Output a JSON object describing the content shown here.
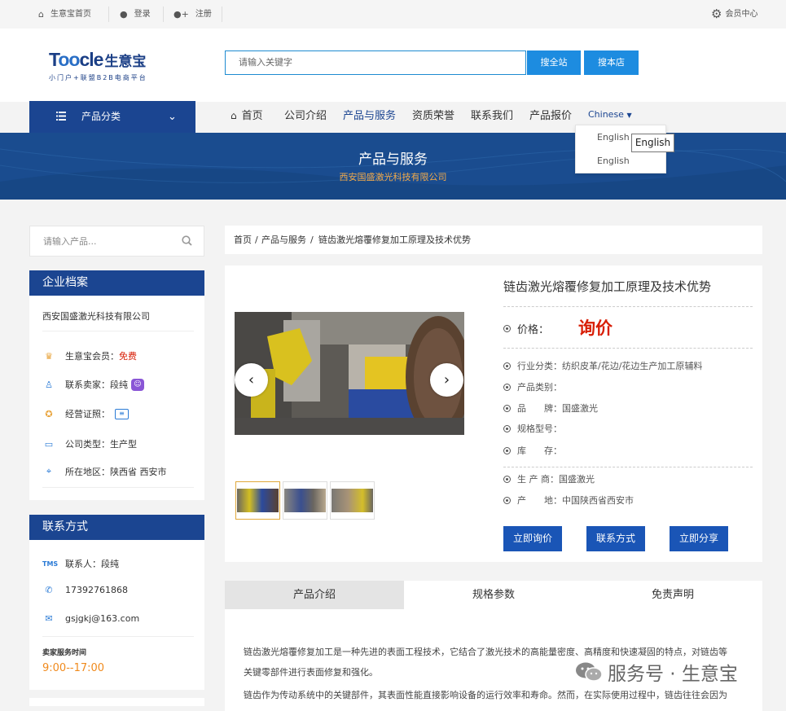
{
  "topbar": {
    "home": "生意宝首页",
    "login": "登录",
    "register": "注册",
    "member_center": "会员中心"
  },
  "logo": {
    "text_prefix": "T",
    "text_oo": "oo",
    "text_suffix": "cle",
    "cn_name": "生意宝",
    "tagline": "小门户+联盟B2B电商平台"
  },
  "search": {
    "placeholder": "请输入关键字",
    "btn_all": "搜全站",
    "btn_store": "搜本店"
  },
  "nav": {
    "category_label": "产品分类",
    "links": [
      "首页",
      "公司介绍",
      "产品与服务",
      "资质荣誉",
      "联系我们",
      "产品报价"
    ],
    "active": "产品与服务",
    "language": "Chinese",
    "language_options": [
      "English",
      "English"
    ],
    "tooltip": "English"
  },
  "banner": {
    "title": "产品与服务",
    "company": "西安国盛激光科技有限公司"
  },
  "sidebar": {
    "search_placeholder": "请输入产品...",
    "profile": {
      "heading": "企业档案",
      "company": "西安国盛激光科技有限公司",
      "member_label": "生意宝会员：",
      "member_value": "免费",
      "seller_label": "联系卖家：",
      "seller_value": "段纯",
      "license_label": "经营证照：",
      "type_label": "公司类型：",
      "type_value": "生产型",
      "region_label": "所在地区：",
      "region_value": "陕西省 西安市"
    },
    "contact": {
      "heading": "联系方式",
      "person": "联系人：段纯",
      "phone": "17392761868",
      "email": "gsjgkj@163.com",
      "hours_label": "卖家服务时间",
      "hours": "9:00--17:00"
    }
  },
  "breadcrumb": {
    "home": "首页",
    "sep1": "/",
    "section": "产品与服务",
    "sep2": "/",
    "current": "链齿激光熔覆修复加工原理及技术优势"
  },
  "product": {
    "title": "链齿激光熔覆修复加工原理及技术优势",
    "price_label": "价格：",
    "price_value": "询价",
    "attrs": [
      "行业分类：纺织皮革/花边/花边生产加工原辅料",
      "产品类别：",
      "品　　牌：国盛激光",
      "规格型号：",
      "库　　存："
    ],
    "origin": [
      "生 产 商：国盛激光",
      "产　　地：中国陕西省西安市"
    ],
    "buttons": [
      "立即询价",
      "联系方式",
      "立即分享"
    ]
  },
  "tabs": [
    "产品介绍",
    "规格参数",
    "免责声明"
  ],
  "description": [
    "链齿激光熔覆修复加工是一种先进的表面工程技术，它结合了激光技术的高能量密度、高精度和快速凝固的特点，对链齿等",
    "关键零部件进行表面修复和强化。",
    "链齿作为传动系统中的关键部件，其表面性能直接影响设备的运行效率和寿命。然而，在实际使用过程中，链齿往往会因为"
  ],
  "watermark": "服务号 · 生意宝",
  "colors": {
    "primary": "#1b4591",
    "accent_blue": "#1d8ce0",
    "price_red": "#d81e06",
    "orange": "#f0a94a"
  }
}
